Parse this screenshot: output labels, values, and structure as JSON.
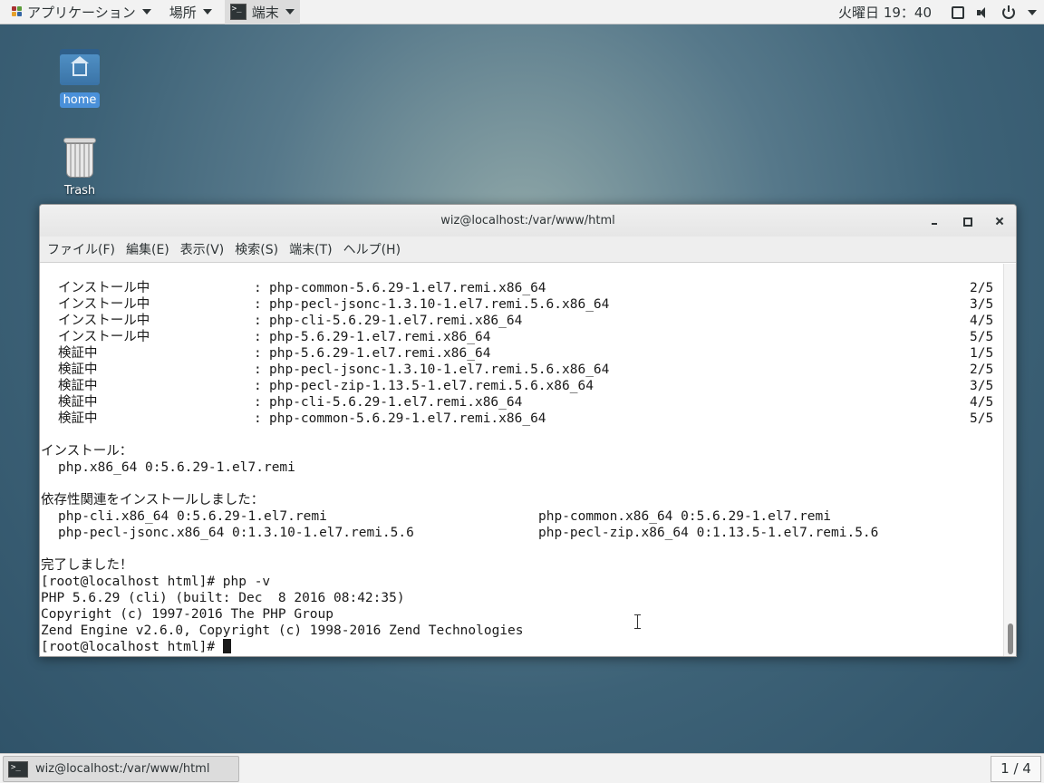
{
  "topbar": {
    "applications_label": "アプリケーション",
    "places_label": "場所",
    "active_app_label": "端末",
    "clock": "火曜日 19：40"
  },
  "desktop": {
    "home_label": "home",
    "trash_label": "Trash"
  },
  "window": {
    "title": "wiz@localhost:/var/www/html",
    "menu": [
      "ファイル(F)",
      "編集(E)",
      "表示(V)",
      "検索(S)",
      "端末(T)",
      "ヘルプ(H)"
    ]
  },
  "terminal": {
    "steps": [
      {
        "action": "インストール中",
        "package": "php-common-5.6.29-1.el7.remi.x86_64",
        "progress": "2/5"
      },
      {
        "action": "インストール中",
        "package": "php-pecl-jsonc-1.3.10-1.el7.remi.5.6.x86_64",
        "progress": "3/5"
      },
      {
        "action": "インストール中",
        "package": "php-cli-5.6.29-1.el7.remi.x86_64",
        "progress": "4/5"
      },
      {
        "action": "インストール中",
        "package": "php-5.6.29-1.el7.remi.x86_64",
        "progress": "5/5"
      },
      {
        "action": "検証中",
        "package": "php-5.6.29-1.el7.remi.x86_64",
        "progress": "1/5"
      },
      {
        "action": "検証中",
        "package": "php-pecl-jsonc-1.3.10-1.el7.remi.5.6.x86_64",
        "progress": "2/5"
      },
      {
        "action": "検証中",
        "package": "php-pecl-zip-1.13.5-1.el7.remi.5.6.x86_64",
        "progress": "3/5"
      },
      {
        "action": "検証中",
        "package": "php-cli-5.6.29-1.el7.remi.x86_64",
        "progress": "4/5"
      },
      {
        "action": "検証中",
        "package": "php-common-5.6.29-1.el7.remi.x86_64",
        "progress": "5/5"
      }
    ],
    "installed_header": "インストール：",
    "installed_pkg": "php.x86_64 0:5.6.29-1.el7.remi",
    "deps_header": "依存性関連をインストールしました：",
    "deps_row1_left": "php-cli.x86_64 0:5.6.29-1.el7.remi",
    "deps_row1_right": "php-common.x86_64 0:5.6.29-1.el7.remi",
    "deps_row2_left": "php-pecl-jsonc.x86_64 0:1.3.10-1.el7.remi.5.6",
    "deps_row2_right": "php-pecl-zip.x86_64 0:1.13.5-1.el7.remi.5.6",
    "done": "完了しました！",
    "prompt_cmd": "[root@localhost html]# php -v",
    "php_version": "PHP 5.6.29 (cli) (built: Dec  8 2016 08:42:35)",
    "copyright": "Copyright (c) 1997-2016 The PHP Group",
    "zend": "Zend Engine v2.6.0, Copyright (c) 1998-2016 Zend Technologies",
    "prompt": "[root@localhost html]# "
  },
  "bottombar": {
    "task_label": "wiz@localhost:/var/www/html",
    "workspace": "1 / 4"
  }
}
